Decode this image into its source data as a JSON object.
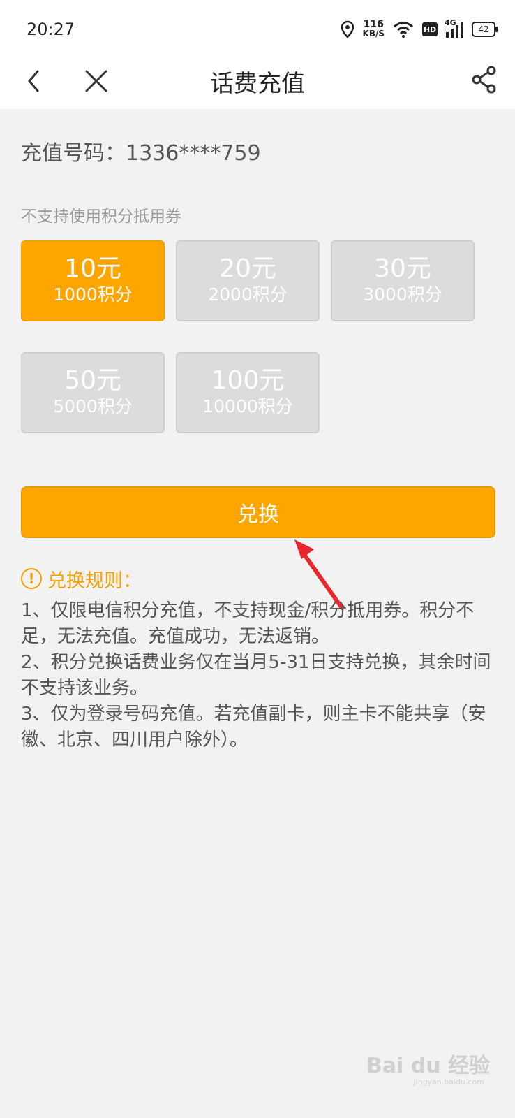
{
  "status": {
    "time": "20:27",
    "speed_value": "116",
    "speed_unit": "KB/S",
    "hd_label": "HD",
    "network": "4G",
    "battery": "42"
  },
  "nav": {
    "title": "话费充值",
    "icons": [
      "back-icon",
      "close-icon",
      "share-icon"
    ]
  },
  "recharge": {
    "phone_label": "充值号码：",
    "phone_number": "1336****759",
    "notice": "不支持使用积分抵用券",
    "options": [
      {
        "amount": "10元",
        "points": "1000积分",
        "selected": true
      },
      {
        "amount": "20元",
        "points": "2000积分",
        "selected": false
      },
      {
        "amount": "30元",
        "points": "3000积分",
        "selected": false
      },
      {
        "amount": "50元",
        "points": "5000积分",
        "selected": false
      },
      {
        "amount": "100元",
        "points": "10000积分",
        "selected": false
      }
    ],
    "exchange_label": "兑换"
  },
  "rules": {
    "title": "兑换规则：",
    "items": [
      "1、仅限电信积分充值，不支持现金/积分抵用券。积分不足，无法充值。充值成功，无法返销。",
      "2、积分兑换话费业务仅在当月5-31日支持兑换，其余时间不支持该业务。",
      "3、仅为登录号码充值。若充值副卡，则主卡不能共享（安徽、北京、四川用户除外）。"
    ]
  },
  "watermark": {
    "text": "Bai du 经验",
    "sub": "jingyan.baidu.com"
  },
  "colors": {
    "accent": "#ffa500",
    "unselected": "#dcdcdc",
    "annotation_arrow": "#e8262b"
  }
}
